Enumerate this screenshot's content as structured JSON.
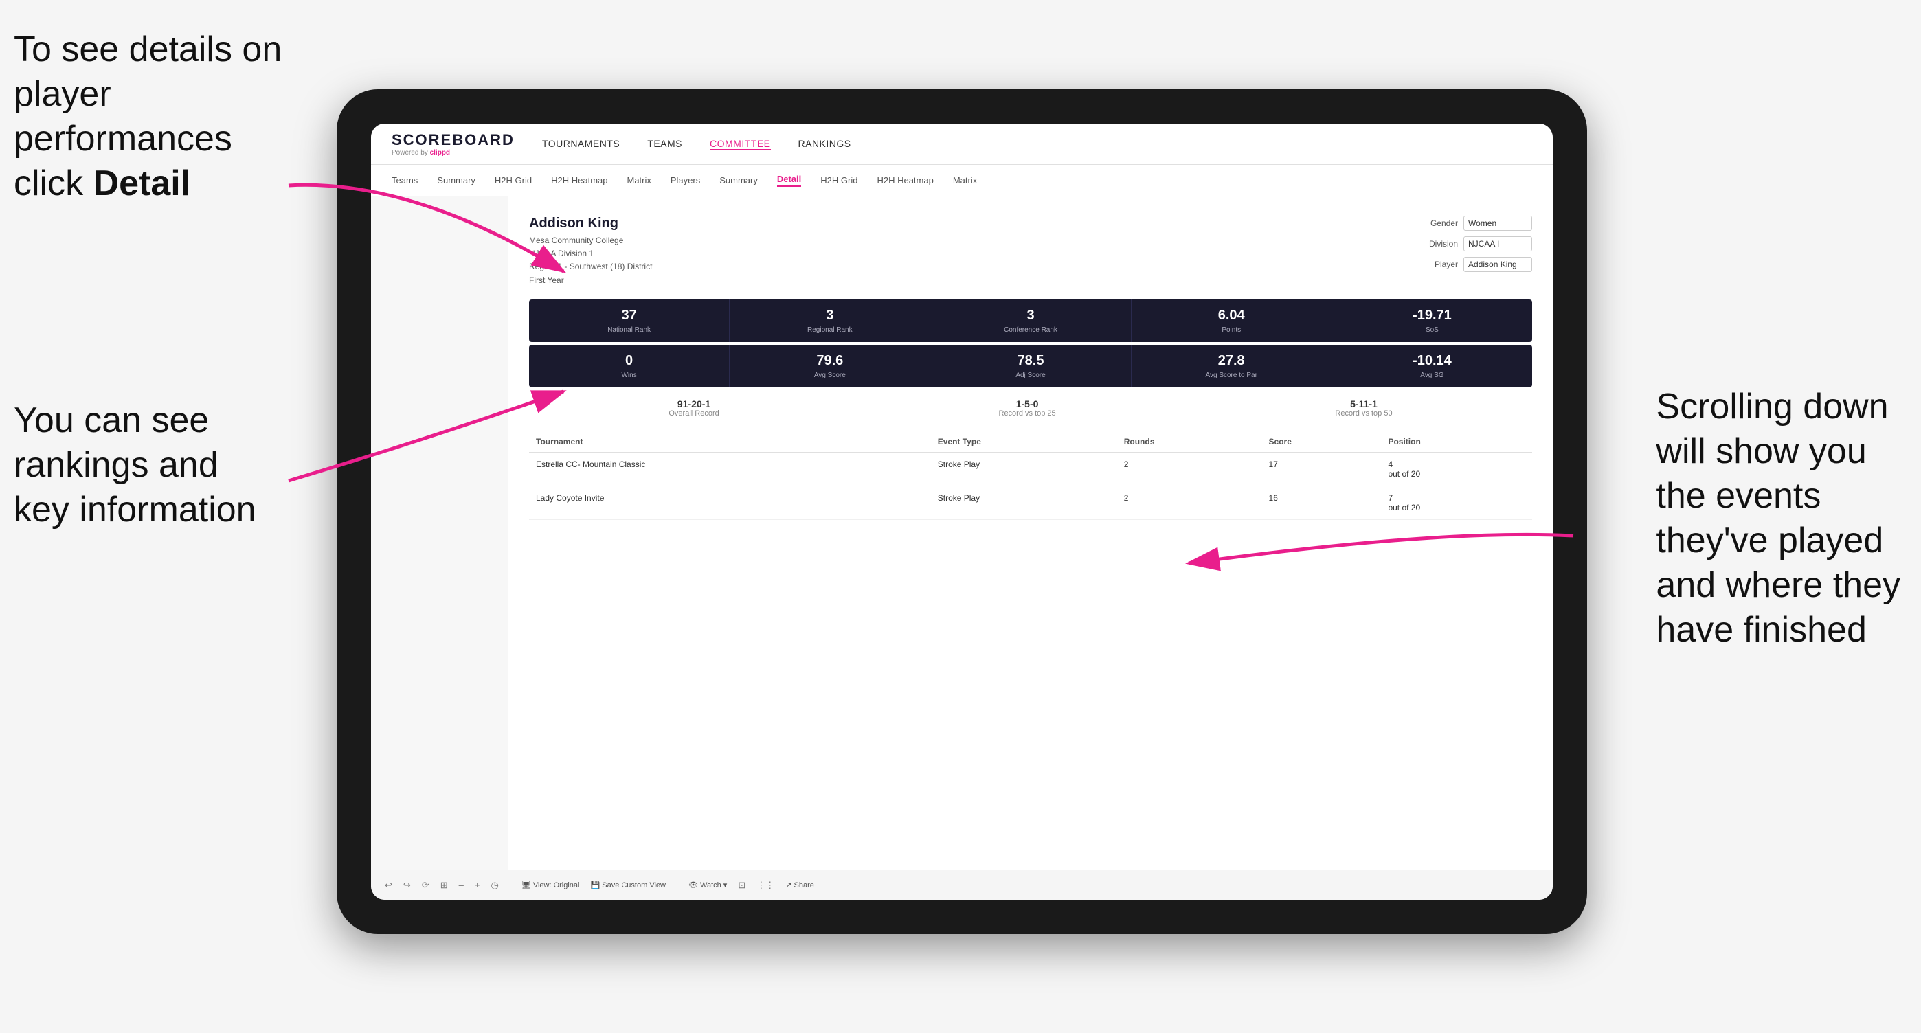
{
  "annotations": {
    "top_left_line1": "To see details on",
    "top_left_line2": "player performances",
    "top_left_line3": "click ",
    "top_left_bold": "Detail",
    "bottom_left_line1": "You can see",
    "bottom_left_line2": "rankings and",
    "bottom_left_line3": "key information",
    "right_line1": "Scrolling down",
    "right_line2": "will show you",
    "right_line3": "the events",
    "right_line4": "they've played",
    "right_line5": "and where they",
    "right_line6": "have finished"
  },
  "nav": {
    "logo": "SCOREBOARD",
    "powered_by": "Powered by",
    "brand": "clippd",
    "items": [
      "TOURNAMENTS",
      "TEAMS",
      "COMMITTEE",
      "RANKINGS"
    ],
    "active": "COMMITTEE"
  },
  "subnav": {
    "items": [
      "Teams",
      "Summary",
      "H2H Grid",
      "H2H Heatmap",
      "Matrix",
      "Players",
      "Summary",
      "Detail",
      "H2H Grid",
      "H2H Heatmap",
      "Matrix"
    ],
    "active": "Detail"
  },
  "player": {
    "name": "Addison King",
    "school": "Mesa Community College",
    "division": "NJCAA Division 1",
    "region": "Region 1 - Southwest (18) District",
    "year": "First Year"
  },
  "filters": {
    "gender_label": "Gender",
    "gender_value": "Women",
    "division_label": "Division",
    "division_value": "NJCAA I",
    "player_label": "Player",
    "player_value": "Addison King"
  },
  "stats_row1": [
    {
      "value": "37",
      "label": "National Rank"
    },
    {
      "value": "3",
      "label": "Regional Rank"
    },
    {
      "value": "3",
      "label": "Conference Rank"
    },
    {
      "value": "6.04",
      "label": "Points"
    },
    {
      "value": "-19.71",
      "label": "SoS"
    }
  ],
  "stats_row2": [
    {
      "value": "0",
      "label": "Wins"
    },
    {
      "value": "79.6",
      "label": "Avg Score"
    },
    {
      "value": "78.5",
      "label": "Adj Score"
    },
    {
      "value": "27.8",
      "label": "Avg Score to Par"
    },
    {
      "value": "-10.14",
      "label": "Avg SG"
    }
  ],
  "records": [
    {
      "value": "91-20-1",
      "label": "Overall Record"
    },
    {
      "value": "1-5-0",
      "label": "Record vs top 25"
    },
    {
      "value": "5-11-1",
      "label": "Record vs top 50"
    }
  ],
  "table": {
    "headers": [
      "Tournament",
      "Event Type",
      "Rounds",
      "Score",
      "Position"
    ],
    "rows": [
      {
        "tournament": "Estrella CC- Mountain Classic",
        "event_type": "Stroke Play",
        "rounds": "2",
        "score": "17",
        "position": "4 out of 20"
      },
      {
        "tournament": "Lady Coyote Invite",
        "event_type": "Stroke Play",
        "rounds": "2",
        "score": "16",
        "position": "7 out of 20"
      }
    ]
  },
  "toolbar": {
    "items": [
      "↩",
      "↪",
      "⟳",
      "⊞",
      "⊟",
      "–",
      "+",
      "◷",
      "|",
      "View: Original",
      "Save Custom View",
      "|",
      "👁 Watch ▾",
      "⊡",
      "⋮⋮",
      "Share"
    ]
  }
}
